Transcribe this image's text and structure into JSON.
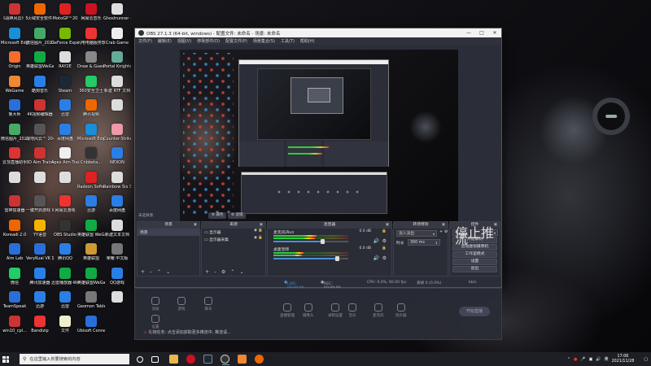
{
  "desktop": {
    "icons": [
      {
        "label": "《战神风云》5",
        "color": "#c33"
      },
      {
        "label": "火绒安全软件",
        "color": "#e60"
      },
      {
        "label": "MotoGP™20",
        "color": "#d22"
      },
      {
        "label": "网易云音乐",
        "color": "#c12"
      },
      {
        "label": "Ghostrunner - 幽灵行者",
        "color": "#ddd"
      },
      {
        "label": "Microsoft Edge",
        "color": "#1a8fd8"
      },
      {
        "label": "微信图片_2021100...",
        "color": "#4a6"
      },
      {
        "label": "GeForce Experience",
        "color": "#76b900"
      },
      {
        "label": "闪电电脑服务软件",
        "color": "#e33"
      },
      {
        "label": "Crab Game",
        "color": "#eee"
      },
      {
        "label": "Origin",
        "color": "#f56c2d"
      },
      {
        "label": "英雄联盟WeGame平台",
        "color": "#1a4"
      },
      {
        "label": "RAY2E",
        "color": "#ddd"
      },
      {
        "label": "Draw & Guess",
        "color": "#888"
      },
      {
        "label": "Portal Knights",
        "color": "#6a9"
      },
      {
        "label": "WeGame",
        "color": "#e83"
      },
      {
        "label": "酷狗音乐",
        "color": "#2a7fe6"
      },
      {
        "label": "Steam",
        "color": "#1b2838"
      },
      {
        "label": "360安全卫士",
        "color": "#2c6"
      },
      {
        "label": "新建 RTF 文档",
        "color": "#ddd"
      },
      {
        "label": "鲁大师",
        "color": "#2a6fd8"
      },
      {
        "label": "4K视频编辑器",
        "color": "#c33"
      },
      {
        "label": "迅雷",
        "color": "#2a7fe6"
      },
      {
        "label": "腾讯视频",
        "color": "#e60"
      },
      {
        "label": "",
        "color": "#ddd"
      },
      {
        "label": "微信图片_2021001...",
        "color": "#4a6"
      },
      {
        "label": "战地风云™ 2042",
        "color": "#555"
      },
      {
        "label": "百度网盘",
        "color": "#2a7fe6"
      },
      {
        "label": "Microsoft Edge",
        "color": "#1a8fd8"
      },
      {
        "label": "Counter-Strike: Global Offensive",
        "color": "#e9a"
      },
      {
        "label": "云顶直播助手",
        "color": "#d33"
      },
      {
        "label": "3D Aim Trainer",
        "color": "#c33"
      },
      {
        "label": "Apex Aim Trainer",
        "color": "#eee"
      },
      {
        "label": "Cnbbeta...",
        "color": "#333"
      },
      {
        "label": "NEXON",
        "color": "#2a7fe6"
      },
      {
        "label": "",
        "color": "#ddd"
      },
      {
        "label": "",
        "color": "#ddd"
      },
      {
        "label": "",
        "color": "#ddd"
      },
      {
        "label": "Radeon Software",
        "color": "#d22"
      },
      {
        "label": "Rainbow Six Siege",
        "color": "#ddd"
      },
      {
        "label": "雷神加速器",
        "color": "#c33"
      },
      {
        "label": "一键开启游戏 Windows ...",
        "color": "#555"
      },
      {
        "label": "网易云游戏",
        "color": "#e33"
      },
      {
        "label": "迅游",
        "color": "#2a7fe6"
      },
      {
        "label": "百度网盘",
        "color": "#2a7fe6"
      },
      {
        "label": "Koreadi 2.0",
        "color": "#e60"
      },
      {
        "label": "YY语音",
        "color": "#f5b400"
      },
      {
        "label": "OBS Studio",
        "color": "#333"
      },
      {
        "label": "英雄联盟 WeGame版",
        "color": "#1a4"
      },
      {
        "label": "新建文本文档",
        "color": "#ddd"
      },
      {
        "label": "Aim Lab",
        "color": "#2a6fd8"
      },
      {
        "label": "VeryKuai VK 加速器",
        "color": "#2a6fd8"
      },
      {
        "label": "腾讯QQ",
        "color": "#2a7fe6"
      },
      {
        "label": "英雄联盟",
        "color": "#c93"
      },
      {
        "label": "荣耀 中文版",
        "color": "#777"
      },
      {
        "label": "微信",
        "color": "#2c6"
      },
      {
        "label": "腾讯加速器",
        "color": "#2a7fe6"
      },
      {
        "label": "迅雷播放器-WeGame版",
        "color": "#1a4"
      },
      {
        "label": "英雄联盟WeGame版",
        "color": "#1a4"
      },
      {
        "label": "QQ游戏",
        "color": "#2a7fe6"
      },
      {
        "label": "TeamSpeak",
        "color": "#2a6fd8"
      },
      {
        "label": "迅游",
        "color": "#2a7fe6"
      },
      {
        "label": "迅雷",
        "color": "#2a7fe6"
      },
      {
        "label": "Geomon Tablet",
        "color": "#777"
      },
      {
        "label": "",
        "color": "#ddd"
      },
      {
        "label": "win10_cpl...",
        "color": "#c33"
      },
      {
        "label": "Bandizip",
        "color": "#e33"
      },
      {
        "label": "文件",
        "color": "#eec"
      },
      {
        "label": "Ubisoft Connect",
        "color": "#2a6fd8"
      }
    ]
  },
  "obs": {
    "title": "OBS 27.1.3 (64-bit, windows) - 配置文件: 未命名 - 场景: 未命名",
    "menu": [
      "文件(F)",
      "编辑(E)",
      "视图(V)",
      "停靠部件(D)",
      "配置文件(P)",
      "场景集合(S)",
      "工具(T)",
      "帮助(H)"
    ],
    "preview_toolbar": {
      "no_source": "未选择源",
      "props": "属性",
      "filters": "滤镜"
    },
    "docks": {
      "scenes": {
        "title": "场景",
        "items": [
          "场景"
        ]
      },
      "sources": {
        "title": "来源",
        "items": [
          "显示器",
          "显示器采集"
        ]
      },
      "mixer": {
        "title": "混音器",
        "channels": [
          {
            "name": "麦克风/Aux",
            "db": "0.0 dB",
            "level": 0.58,
            "volume": 0.65
          },
          {
            "name": "桌面音频",
            "db": "0.0 dB",
            "level": 0.4,
            "volume": 0.85
          }
        ]
      },
      "transitions": {
        "title": "转场特效",
        "type": "淡入淡出",
        "duration_label": "时长",
        "duration": "300 ms"
      },
      "controls": {
        "title": "控件",
        "buttons": [
          "停止推流",
          "开始录制",
          "启动虚拟摄像机",
          "工作室模式",
          "设置",
          "退出"
        ]
      }
    },
    "status": {
      "live": "LIVE: 00:00:00",
      "rec": "REC: 00:00:00",
      "cpu": "CPU: 0.0%, 60.00 fps",
      "dropped": "丢帧 0 (0.0%)",
      "kbps": "kb/s"
    }
  },
  "back_window": {
    "buttons": [
      "添加",
      "游戏",
      "聊天",
      "设置",
      "直播管理",
      "摄像头",
      "录制设置",
      "音乐",
      "麦克风",
      "扬声器"
    ],
    "warning": "礼物任务: 点击添加获取更多推流中, 推流请...",
    "start_live": "开始直播"
  },
  "taskbar": {
    "search_placeholder": "在这里输入你要搜索的内容",
    "time": "17:06",
    "date": "2021/11/28",
    "lang": "英"
  }
}
